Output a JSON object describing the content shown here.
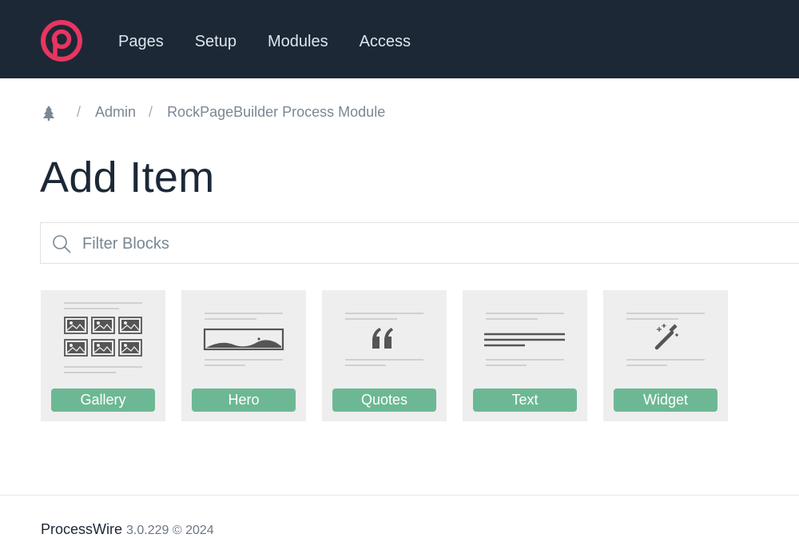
{
  "header": {
    "logo_icon": "processwire-logo-icon",
    "nav": [
      "Pages",
      "Setup",
      "Modules",
      "Access"
    ]
  },
  "breadcrumb": {
    "home_icon": "tree-icon",
    "items": [
      "Admin",
      "RockPageBuilder Process Module"
    ]
  },
  "page": {
    "title": "Add Item"
  },
  "filter": {
    "placeholder": "Filter Blocks",
    "value": ""
  },
  "blocks": [
    {
      "label": "Gallery",
      "icon": "gallery-thumbnail-icon"
    },
    {
      "label": "Hero",
      "icon": "hero-thumbnail-icon"
    },
    {
      "label": "Quotes",
      "icon": "quotes-thumbnail-icon"
    },
    {
      "label": "Text",
      "icon": "text-thumbnail-icon"
    },
    {
      "label": "Widget",
      "icon": "magic-wand-thumbnail-icon"
    }
  ],
  "footer": {
    "brand": "ProcessWire",
    "version": "3.0.229 © 2024"
  },
  "colors": {
    "topbar": "#1c2836",
    "logo": "#e83561",
    "block_label": "#6db894",
    "block_bg": "#eeeeee"
  }
}
